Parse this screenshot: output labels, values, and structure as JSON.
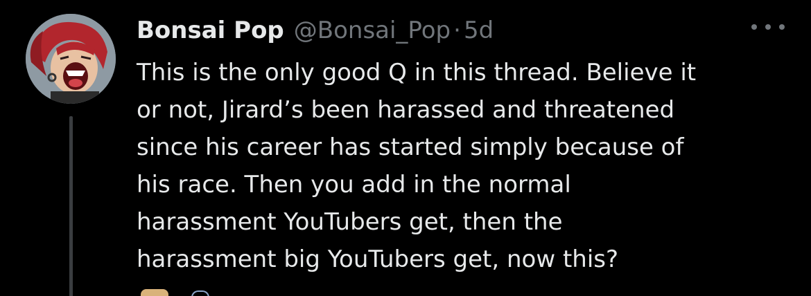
{
  "tweet": {
    "author": {
      "display_name": "Bonsai Pop",
      "handle": "@Bonsai_Pop",
      "separator": "·",
      "timestamp": "5d",
      "avatar_icon": "avatar-illustration"
    },
    "more_icon": "more-options-icon",
    "text_lines": [
      "This is the only good Q in this thread. Believe it",
      "or not, Jirard’s been harassed and threatened",
      "since his career has started simply because of",
      "his race. Then you add in the normal",
      "harassment YouTubers get, then the",
      "harassment big YouTubers get, now this?"
    ]
  },
  "colors": {
    "background": "#000000",
    "primary_text": "#e7e9ea",
    "secondary_text": "#71767b",
    "thread_line": "#3a3d40"
  }
}
